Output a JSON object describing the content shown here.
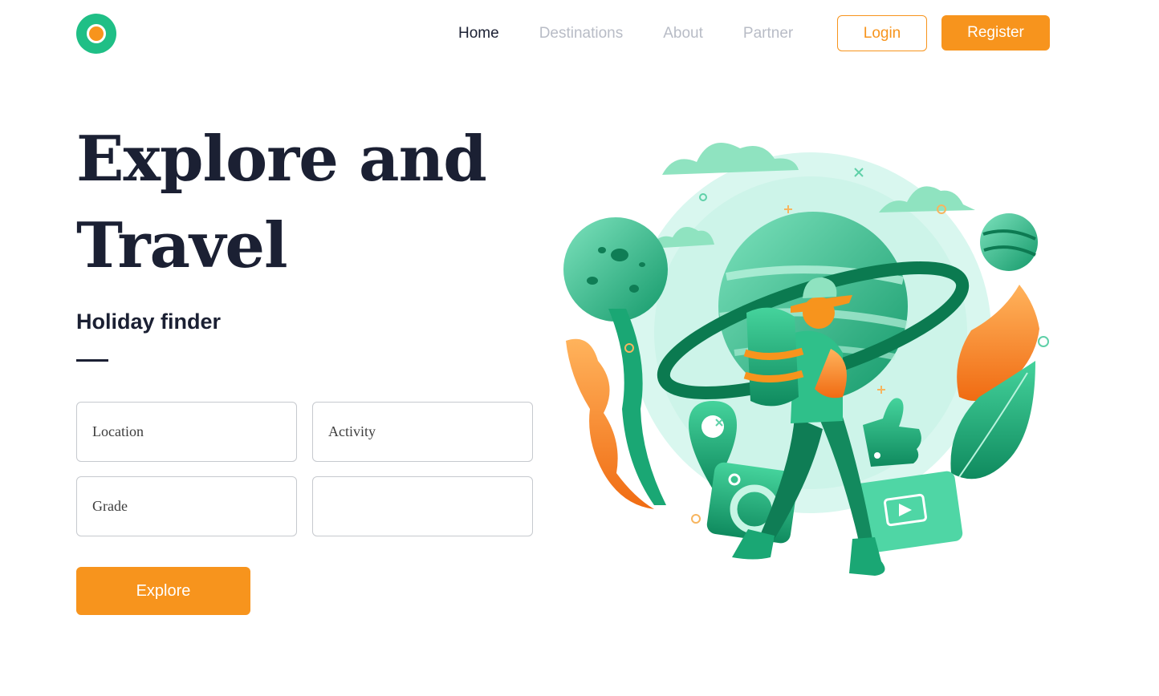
{
  "nav": {
    "links": [
      "Home",
      "Destinations",
      "About",
      "Partner"
    ],
    "active": "Home",
    "login_label": "Login",
    "register_label": "Register"
  },
  "hero": {
    "title_line1": "Explore and",
    "title_line2": "Travel",
    "subtitle": "Holiday finder"
  },
  "form": {
    "location_placeholder": "Location",
    "activity_placeholder": "Activity",
    "grade_placeholder": "Grade",
    "extra_placeholder": "",
    "submit_label": "Explore"
  },
  "colors": {
    "accent": "#f7941d",
    "brand": "#1fbf86",
    "text": "#1b2033",
    "muted": "#b8bcc6"
  },
  "icons": {
    "logo": "ring-logo-icon"
  }
}
